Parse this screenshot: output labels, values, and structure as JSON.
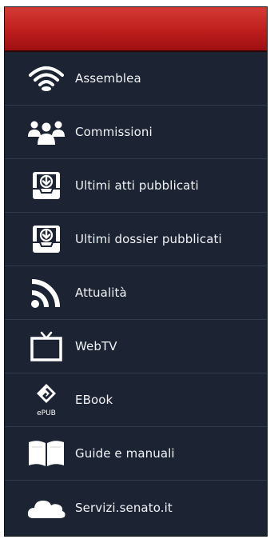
{
  "header": {
    "color": "#c4211e"
  },
  "menu": {
    "items": [
      {
        "label": "Assemblea",
        "icon": "wireless-signal-icon"
      },
      {
        "label": "Commissioni",
        "icon": "people-group-icon"
      },
      {
        "label": "Ultimi atti pubblicati",
        "icon": "inbox-download-icon"
      },
      {
        "label": "Ultimi dossier pubblicati",
        "icon": "inbox-download-icon"
      },
      {
        "label": "Attualità",
        "icon": "rss-feed-icon"
      },
      {
        "label": "WebTV",
        "icon": "television-icon"
      },
      {
        "label": "EBook",
        "icon": "epub-icon",
        "icon_text": "ePUB"
      },
      {
        "label": "Guide e manuali",
        "icon": "open-book-icon"
      },
      {
        "label": "Servizi.senato.it",
        "icon": "cloud-icon"
      }
    ]
  }
}
